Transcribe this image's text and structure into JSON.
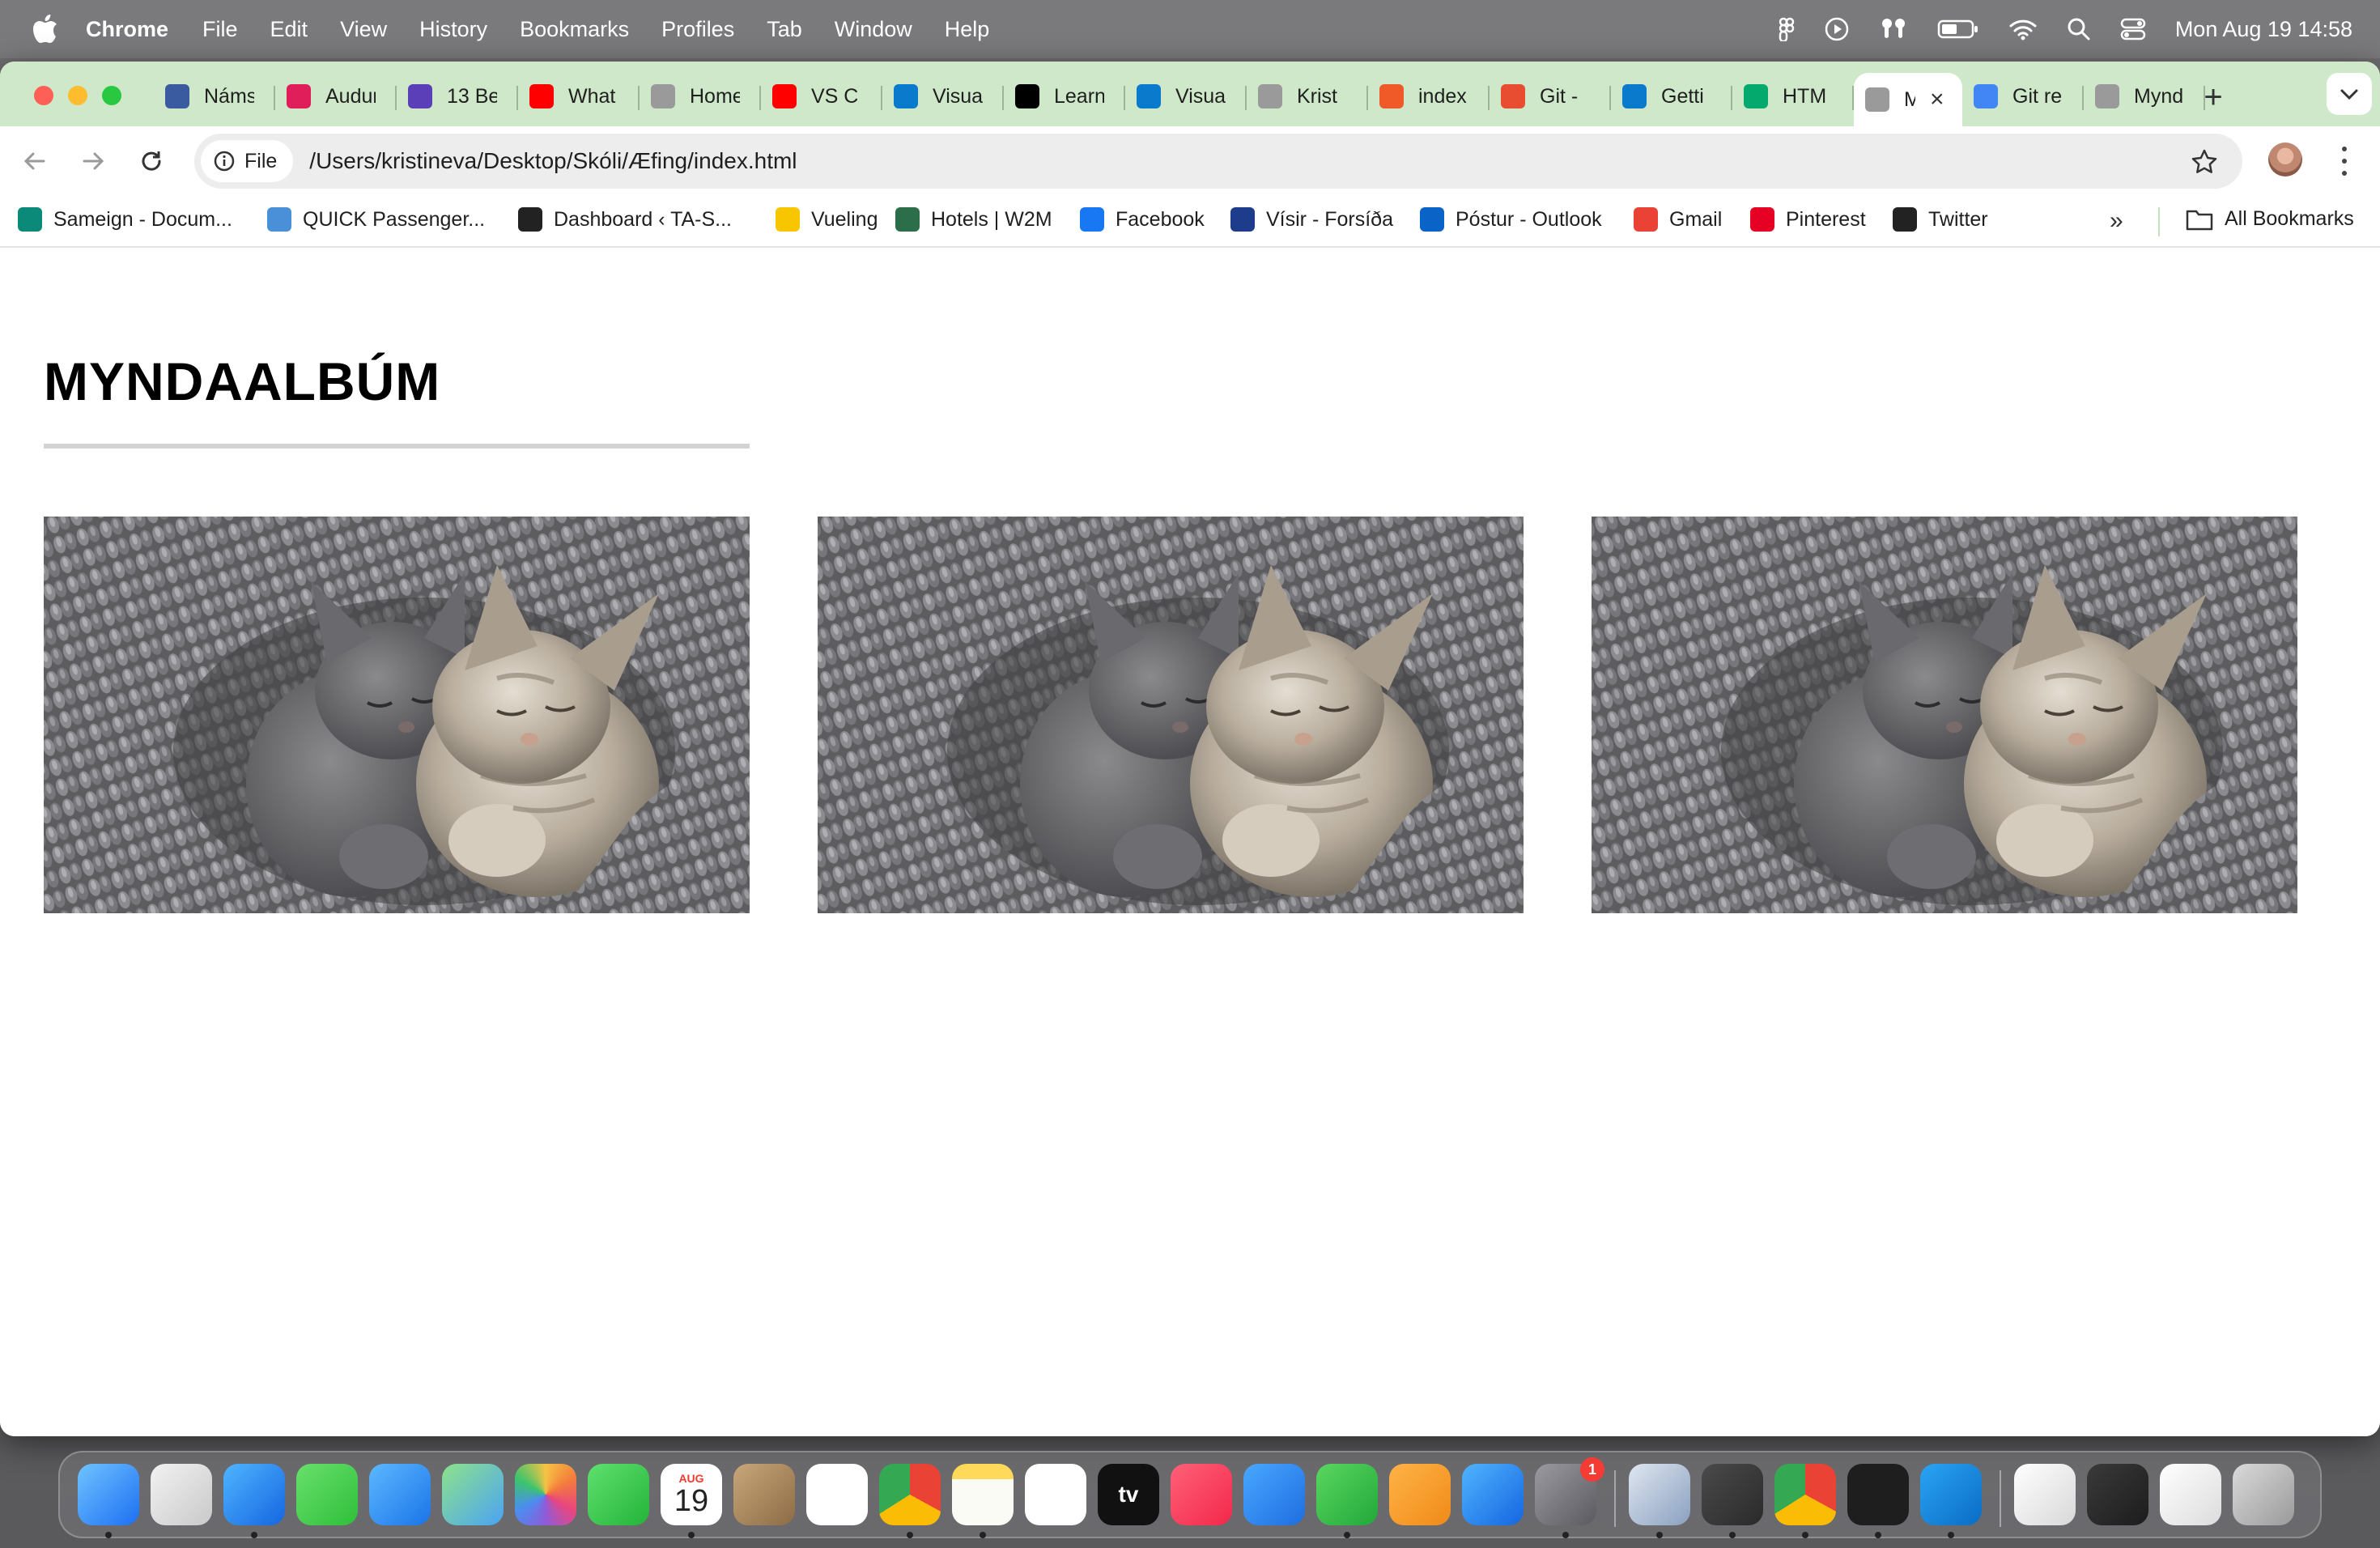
{
  "menubar": {
    "app_name": "Chrome",
    "items": [
      "File",
      "Edit",
      "View",
      "History",
      "Bookmarks",
      "Profiles",
      "Tab",
      "Window",
      "Help"
    ],
    "clock": "Mon Aug 19  14:58"
  },
  "tabs": [
    {
      "label": "Námsk",
      "color": "#3a5ba0"
    },
    {
      "label": "Audur",
      "color": "#e01e5a"
    },
    {
      "label": "13 Be",
      "color": "#5b3fb8"
    },
    {
      "label": "What",
      "color": "#ff0000"
    },
    {
      "label": "Home",
      "color": "#9a9a9a"
    },
    {
      "label": "VS C",
      "color": "#ff0000"
    },
    {
      "label": "Visua",
      "color": "#0a7acc"
    },
    {
      "label": "Learn",
      "color": "#000000"
    },
    {
      "label": "Visua",
      "color": "#0a7acc"
    },
    {
      "label": "Krist",
      "color": "#9a9a9a"
    },
    {
      "label": "index",
      "color": "#f05a28"
    },
    {
      "label": "Git -",
      "color": "#e84d31"
    },
    {
      "label": "Getti",
      "color": "#0a7acc"
    },
    {
      "label": "HTM",
      "color": "#04aa6d"
    },
    {
      "label": "M",
      "color": "#9a9a9a",
      "active": true
    },
    {
      "label": "Git re",
      "color": "#4285f4"
    },
    {
      "label": "Mynd",
      "color": "#9a9a9a"
    }
  ],
  "toolbar": {
    "chip_label": "File",
    "url": "/Users/kristineva/Desktop/Skóli/Æfing/index.html"
  },
  "bookmarks": [
    {
      "label": "Sameign - Docum...",
      "color": "#0b8a7a"
    },
    {
      "label": "QUICK Passenger...",
      "color": "#4a90d9"
    },
    {
      "label": "Dashboard ‹ TA-S...",
      "color": "#222222"
    },
    {
      "label": "Vueling",
      "color": "#f7c600"
    },
    {
      "label": "Hotels | W2M",
      "color": "#2c6e49"
    },
    {
      "label": "Facebook",
      "color": "#1877f2"
    },
    {
      "label": "Vísir - Forsíða",
      "color": "#1e3c8c"
    },
    {
      "label": "Póstur - Outlook",
      "color": "#0a64c8"
    },
    {
      "label": "Gmail",
      "color": "#ea4335"
    },
    {
      "label": "Pinterest",
      "color": "#e60023"
    },
    {
      "label": "Twitter",
      "color": "#222222"
    }
  ],
  "bookmarks_all": "All Bookmarks",
  "page": {
    "title": "MYNDAALBÚM",
    "images": [
      {
        "alt": "Two kittens sleeping on knitted blanket"
      },
      {
        "alt": "Two kittens sleeping on knitted blanket"
      },
      {
        "alt": "Two kittens sleeping on knitted blanket"
      }
    ]
  },
  "dock": {
    "calendar_month": "AUG",
    "calendar_day": "19",
    "settings_badge": "1",
    "tv_label": "tv"
  }
}
